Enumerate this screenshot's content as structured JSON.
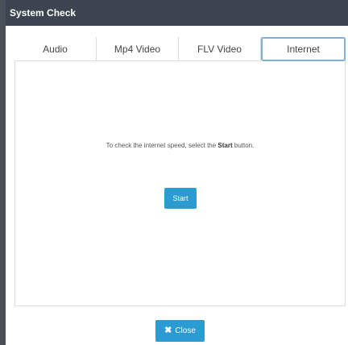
{
  "window": {
    "title": "System Check"
  },
  "tabs": [
    {
      "label": "Audio",
      "active": false
    },
    {
      "label": "Mp4 Video",
      "active": false
    },
    {
      "label": "FLV Video",
      "active": false
    },
    {
      "label": "Internet",
      "active": true
    }
  ],
  "internet": {
    "instruction_prefix": "To check the internet speed, select the ",
    "instruction_bold": "Start",
    "instruction_suffix": " button.",
    "start_label": "Start"
  },
  "footer": {
    "close_label": "Close",
    "close_icon": "close-icon"
  },
  "colors": {
    "titlebar": "#3d4450",
    "accent": "#2b9bd1",
    "active_tab_border": "#7fb0d6"
  }
}
